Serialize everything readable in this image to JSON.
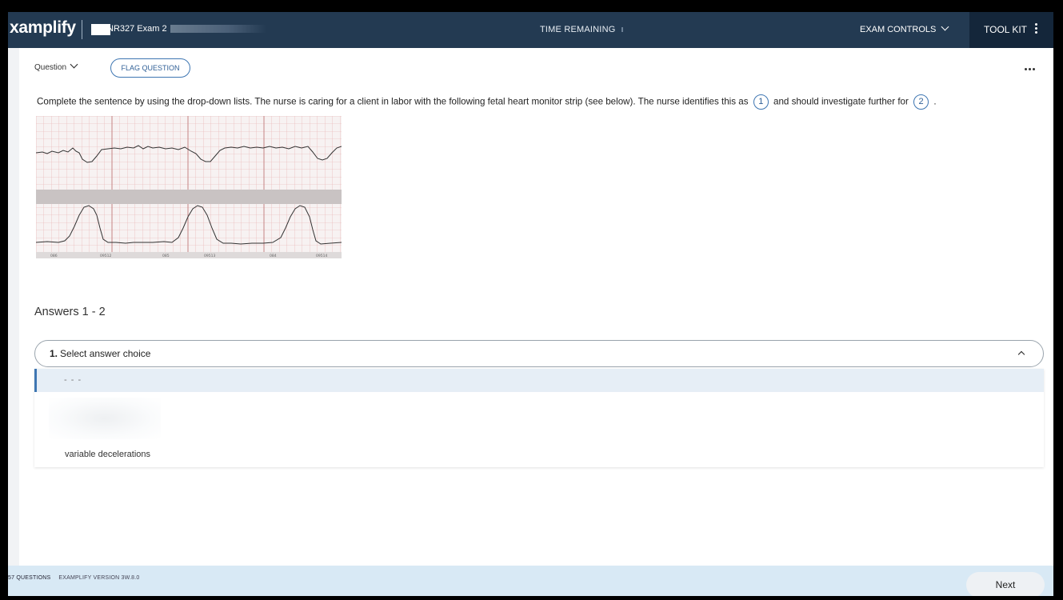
{
  "header": {
    "logo": "xamplify",
    "exam_title": "NR327 Exam 2",
    "time_label": "TIME REMAINING",
    "exam_controls": "EXAM CONTROLS",
    "tool_kit": "TOOL KIT"
  },
  "question": {
    "label": "Question",
    "flag_button": "FLAG QUESTION",
    "prompt_part1": "Complete the sentence by using the drop-down lists. The nurse is caring for a client in labor with the following fetal heart monitor strip (see below). The nurse identifies this as",
    "blank1": "1",
    "prompt_part2": "and should investigate further for",
    "blank2": "2",
    "prompt_end": "."
  },
  "strip_labels": [
    "086",
    "09512",
    "085",
    "09513",
    "084",
    "09514"
  ],
  "answers": {
    "title": "Answers 1 - 2",
    "select": {
      "number": "1.",
      "label": "Select answer choice"
    },
    "options": [
      "- - -",
      "variable decelerations"
    ]
  },
  "footer": {
    "questions_count": "57 QUESTIONS",
    "version": "EXAMPLIFY VERSION 3W.8.0",
    "next_button": "Next"
  },
  "colors": {
    "topbar": "#233a52",
    "toolkit": "#14263a",
    "accent": "#3e76b2",
    "footer": "#d8e9f5",
    "grid": "#e6a9a9"
  }
}
